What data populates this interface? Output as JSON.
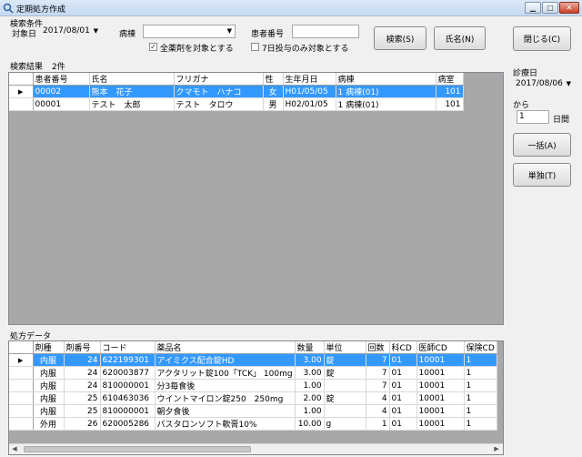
{
  "window": {
    "title": "定期処方作成",
    "minimize_glyph": "▁",
    "maximize_glyph": "□",
    "close_glyph": "✕"
  },
  "search": {
    "group_label": "検索条件",
    "target_date_label": "対象日",
    "target_date_value": "2017/08/01",
    "ward_label": "病棟",
    "ward_value": "",
    "patient_no_label": "患者番号",
    "patient_no_value": "",
    "all_drugs_label": "全薬剤を対象とする",
    "all_drugs_checked": "✓",
    "seven_day_label": "7日投与のみ対象とする",
    "search_button": "検索(S)",
    "name_button": "氏名(N)"
  },
  "close_button": "閉じる(C)",
  "results": {
    "label": "検索結果",
    "count": "2件",
    "columns": [
      "患者番号",
      "氏名",
      "フリガナ",
      "性",
      "生年月日",
      "病棟",
      "病室"
    ],
    "rows": [
      {
        "patient_no": "00002",
        "name": "熊本　花子",
        "kana": "クマモト　ハナコ",
        "sex": "女",
        "birth": "H01/05/05",
        "ward": "1 病棟(01)",
        "room": "101",
        "selected": true
      },
      {
        "patient_no": "00001",
        "name": "テスト　太郎",
        "kana": "テスト　タロウ",
        "sex": "男",
        "birth": "H02/01/05",
        "ward": "1 病棟(01)",
        "room": "101",
        "selected": false
      }
    ]
  },
  "side": {
    "exam_date_label": "診療日",
    "exam_date_value": "2017/08/06",
    "from_label": "から",
    "days_value": "1",
    "days_unit": "日間",
    "bulk_button": "一括(A)",
    "single_button": "単独(T)"
  },
  "prescription": {
    "label": "処方データ",
    "columns": [
      "剤種",
      "剤番号",
      "コード",
      "薬品名",
      "数量",
      "単位",
      "回数",
      "科CD",
      "医師CD",
      "保険CD"
    ],
    "rows": [
      {
        "kind": "内服",
        "no": "24",
        "code": "622199301",
        "drug": "アイミクス配合錠HD",
        "qty": "3.00",
        "unit": "錠",
        "times": "7",
        "dept": "01",
        "doctor": "10001",
        "ins": "1",
        "selected": true
      },
      {
        "kind": "内服",
        "no": "24",
        "code": "620003877",
        "drug": "アクタリット錠100「TCK」 100mg",
        "qty": "3.00",
        "unit": "錠",
        "times": "7",
        "dept": "01",
        "doctor": "10001",
        "ins": "1",
        "selected": false
      },
      {
        "kind": "内服",
        "no": "24",
        "code": "810000001",
        "drug": "分3毎食後",
        "qty": "1.00",
        "unit": "",
        "times": "7",
        "dept": "01",
        "doctor": "10001",
        "ins": "1",
        "selected": false
      },
      {
        "kind": "内服",
        "no": "25",
        "code": "610463036",
        "drug": "ウイントマイロン錠250　250mg",
        "qty": "2.00",
        "unit": "錠",
        "times": "4",
        "dept": "01",
        "doctor": "10001",
        "ins": "1",
        "selected": false
      },
      {
        "kind": "内服",
        "no": "25",
        "code": "810000001",
        "drug": "朝夕食後",
        "qty": "1.00",
        "unit": "",
        "times": "4",
        "dept": "01",
        "doctor": "10001",
        "ins": "1",
        "selected": false
      },
      {
        "kind": "外用",
        "no": "26",
        "code": "620005286",
        "drug": "パスタロンソフト軟膏10%",
        "qty": "10.00",
        "unit": "g",
        "times": "1",
        "dept": "01",
        "doctor": "10001",
        "ins": "1",
        "selected": false
      }
    ],
    "row_pointer": "▶",
    "scroll_left": "◀",
    "scroll_right": "▶"
  },
  "colors": {
    "selection": "#3399ff",
    "grid_empty": "#a8a8a8"
  }
}
